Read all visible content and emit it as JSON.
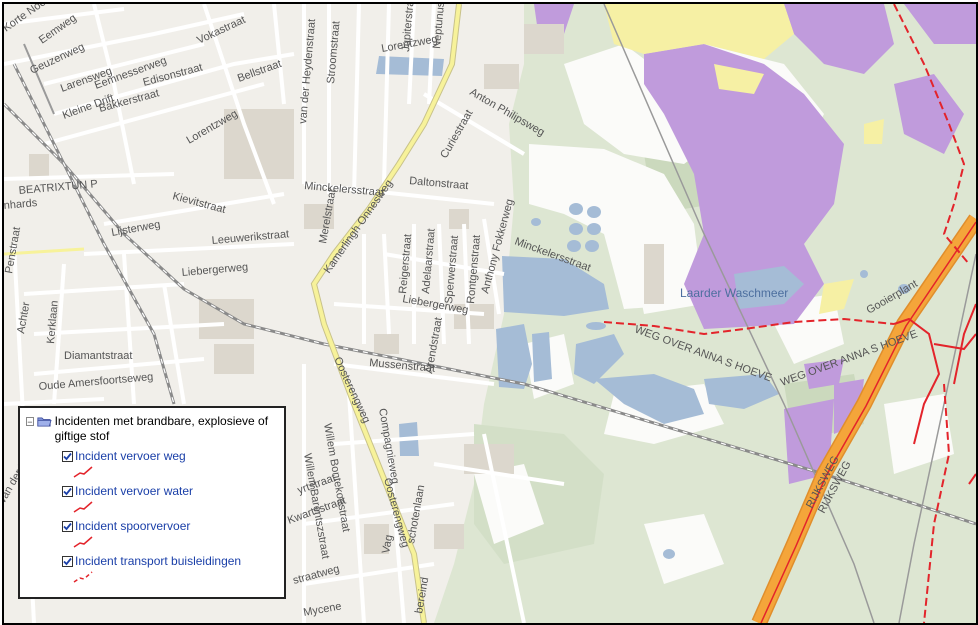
{
  "map": {
    "streets": {
      "korte_noorde": "Korte Noorde",
      "eemweg": "Eemweg",
      "geuzenweg": "Geuzenweg",
      "larensweg": "Larensweg",
      "eemnesserweg": "Eemnesserweg",
      "edisonstraat": "Edisonstraat",
      "bakkerstraat": "Bakkerstraat",
      "kleine_drift": "Kleine Drift",
      "lorentzweg_w": "Lorentzweg",
      "vokastraat": "Vokastraat",
      "bellstraat": "Bellstraat",
      "van_der_heydenstraat": "van der Heydenstraat",
      "stroomstraat": "Stroomstraat",
      "jupiterstraat": "Jupiterstraat",
      "neptunus": "Neptunus",
      "lorentzweg_e": "Lorentzweg",
      "anton_philipsweg": "Anton Philipsweg",
      "curiestraat": "Curiestraat",
      "daltonstraat": "Daltonstraat",
      "minckelersstraat": "Minckelersstraat",
      "minckelersstraat_e": "Minckelersstraat",
      "kamerlingh_onnesweg": "Kamerlingh Onnesweg",
      "merelstraat": "Merelstraat",
      "kievitstraat": "Kievitstraat",
      "lijsterweg": "Lijsterweg",
      "leeuwerikstraat": "Leeuwerikstraat",
      "liebergerweg_w": "Liebergerweg",
      "liebergerweg_e": "Liebergerweg",
      "reigerstraat": "Reigerstraat",
      "adelaarstraat": "Adelaarstraat",
      "sperwerstraat": "Sperwerstraat",
      "rontgenstraat": "Rontgenstraat",
      "anthony_fokkerweg": "Anthony Fokkerweg",
      "arendstraat": "Arendstraat",
      "mussenstraat": "Mussenstraat",
      "diamantstraat": "Diamantstraat",
      "oude_amersfoortseweg": "Oude Amersfoortseweg",
      "oosterengweg": "Oosterengweg",
      "oosterengweg_s": "Oosterengweg",
      "compagnieweg": "Compagnieweg",
      "willem_bontekoestraat": "Willem Bontekoestraat",
      "willem_barentszstraat": "Willem Barentszstraat",
      "kerklaan": "Kerklaan",
      "achterom": "Achter",
      "beatrixtun": "BEATRIXTUN P",
      "pentstraat": "Penstraat",
      "van_der_heijden": "van der Heijden",
      "kwartsstraat": "Kwartsstraat",
      "mycene": "Mycene",
      "vaginastraat": "Vag",
      "schotenlaan": "schotenlaan",
      "bereind": "bereind",
      "weg_over_annas_hoeve": "WEG OVER ANNA S HOEVE",
      "weg_over_annas_hoeve_2": "WEG OVER ANNA S HOEVE",
      "goolerplant": "Gooierplant",
      "rijksweg": "RIJKSWEG",
      "rijksweg_2": "RIJKSWEG",
      "straatweg": "straatweg",
      "yrtstraat": "yrtstraat",
      "hards": "nhards"
    },
    "water": {
      "laarder_waschmeer": "Laarder Waschmeer"
    },
    "colors": {
      "background": "#f1efea",
      "road_minor": "#ffffff",
      "road_major": "#f7f29a",
      "heath": "#c09bdc",
      "sand": "#f6f0a4",
      "forest": "#dde6d2",
      "water": "#a5bcd6",
      "motorway": "#f4a53a",
      "incident_line": "#e3242b",
      "railway": "#9a9a9a",
      "building": "#dcd7cd"
    }
  },
  "legend": {
    "title": "Incidenten met brandbare, explosieve of giftige stof",
    "expander": "−",
    "items": [
      {
        "label": "Incident vervoer weg",
        "checked": true,
        "style": "solid"
      },
      {
        "label": "Incident vervoer water",
        "checked": true,
        "style": "solid"
      },
      {
        "label": "Incident spoorvervoer",
        "checked": true,
        "style": "solid"
      },
      {
        "label": "Incident transport buisleidingen",
        "checked": true,
        "style": "dashed"
      }
    ]
  }
}
